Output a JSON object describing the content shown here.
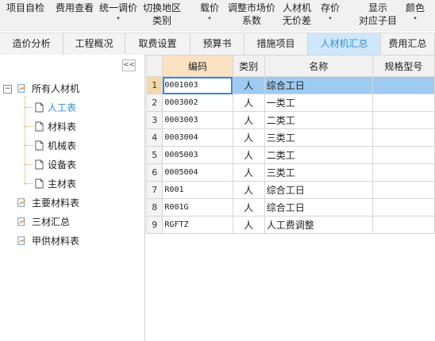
{
  "toolbar": {
    "items": [
      {
        "line1": "项目自检",
        "line2": ""
      },
      {
        "line1": "费用查看",
        "line2": ""
      },
      {
        "line1": "统一调价",
        "line2": "▾"
      },
      {
        "line1": "切换地区",
        "line2": "类别"
      },
      {
        "line1": "载价",
        "line2": "▾"
      },
      {
        "line1": "调整市场价",
        "line2": "系数"
      },
      {
        "line1": "人材机",
        "line2": "无价差"
      },
      {
        "line1": "存价",
        "line2": "▾"
      },
      {
        "line1": "显示",
        "line2": "对应子目"
      },
      {
        "line1": "颜色",
        "line2": "▾"
      }
    ]
  },
  "tabs": [
    {
      "label": "造价分析"
    },
    {
      "label": "工程概况"
    },
    {
      "label": "取费设置"
    },
    {
      "label": "预算书"
    },
    {
      "label": "措施项目"
    },
    {
      "label": "人材机汇总",
      "active": true
    },
    {
      "label": "费用汇总"
    }
  ],
  "tree": {
    "collapse_label": "<<",
    "expander": "−",
    "root": "所有人材机",
    "children": [
      "人工表",
      "材料表",
      "机械表",
      "设备表",
      "主材表"
    ],
    "selected": "人工表",
    "others": [
      "主要材料表",
      "三材汇总",
      "甲供材料表"
    ]
  },
  "grid": {
    "headers": [
      "",
      "编码",
      "类别",
      "名称",
      "规格型号"
    ],
    "rows": [
      {
        "no": "1",
        "code": "0001003",
        "type": "人",
        "name": "综合工日",
        "spec": ""
      },
      {
        "no": "2",
        "code": "0003002",
        "type": "人",
        "name": "一类工",
        "spec": ""
      },
      {
        "no": "3",
        "code": "0003003",
        "type": "人",
        "name": "二类工",
        "spec": ""
      },
      {
        "no": "4",
        "code": "0003004",
        "type": "人",
        "name": "三类工",
        "spec": ""
      },
      {
        "no": "5",
        "code": "0005003",
        "type": "人",
        "name": "二类工",
        "spec": ""
      },
      {
        "no": "6",
        "code": "0005004",
        "type": "人",
        "name": "三类工",
        "spec": ""
      },
      {
        "no": "7",
        "code": "R001",
        "type": "人",
        "name": "综合工日",
        "spec": ""
      },
      {
        "no": "8",
        "code": "R001G",
        "type": "人",
        "name": "综合工日",
        "spec": ""
      },
      {
        "no": "9",
        "code": "RGFTZ",
        "type": "人",
        "name": "人工费调整",
        "spec": ""
      }
    ]
  },
  "colors": {
    "accent": "#2f8fd8",
    "active_tab": "#cfe7fb",
    "selected_row": "#9ecbf1",
    "header_selected": "#fbe2c2"
  }
}
